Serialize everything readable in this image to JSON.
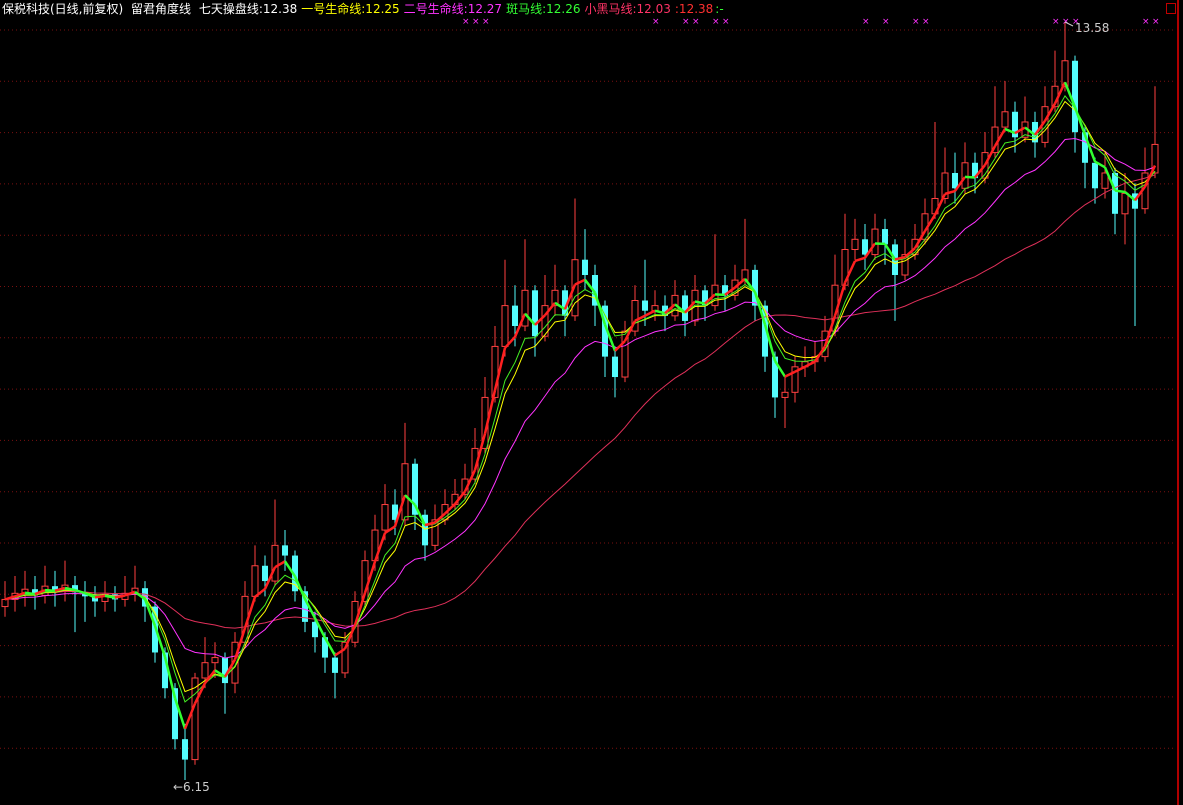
{
  "header": {
    "title": "保税科技(日线,前复权)",
    "indicator": "留君角度线",
    "items": [
      {
        "label": "七天操盘线:12.38",
        "color": "#ffffff"
      },
      {
        "label": "一号生命线:12.25",
        "color": "#ffff00"
      },
      {
        "label": "二号生命线:12.27",
        "color": "#ff33ff"
      },
      {
        "label": "斑马线:12.26",
        "color": "#33ff33"
      },
      {
        "label": "小黑马线:12.03",
        "color": "#ff3366"
      },
      {
        "label": ":12.38",
        "color": "#ff3030"
      },
      {
        "label": ":-",
        "color": "#33ff33"
      }
    ]
  },
  "chart_data": {
    "type": "candlestick",
    "title": "保税科技(日线,前复权)",
    "ylim": [
      6.15,
      13.58
    ],
    "grid": true,
    "colors": {
      "up": "#ff4040",
      "down": "#54fcfc",
      "ma_fast_up": "#ff2020",
      "ma_fast_down": "#30ff30",
      "line1": "#ffff00",
      "line2": "#ff33ff",
      "zebra": "#44ee22",
      "horse": "#e0305a",
      "signal": "#ff33ff",
      "grid": "#7a1010"
    },
    "open": [
      7.85,
      7.92,
      7.98,
      8.02,
      7.96,
      8.05,
      8.0,
      8.06,
      7.99,
      7.95,
      7.9,
      7.97,
      7.92,
      7.98,
      8.03,
      7.85,
      7.4,
      7.05,
      6.55,
      6.35,
      7.15,
      7.3,
      7.35,
      7.1,
      7.5,
      7.95,
      8.25,
      8.1,
      8.45,
      8.35,
      8.0,
      7.7,
      7.55,
      7.35,
      7.2,
      7.5,
      7.9,
      8.3,
      8.6,
      8.85,
      8.7,
      9.25,
      8.75,
      8.45,
      8.7,
      8.85,
      8.95,
      9.1,
      9.4,
      9.9,
      10.4,
      10.8,
      10.6,
      10.95,
      10.5,
      10.8,
      10.95,
      10.7,
      11.25,
      11.1,
      10.8,
      10.3,
      10.1,
      10.55,
      10.85,
      10.75,
      10.8,
      10.7,
      10.9,
      10.65,
      10.95,
      10.8,
      11.0,
      10.9,
      11.05,
      11.15,
      10.8,
      10.3,
      9.9,
      9.95,
      10.2,
      10.25,
      10.3,
      10.55,
      11.0,
      11.35,
      11.45,
      11.3,
      11.55,
      11.4,
      11.1,
      11.3,
      11.45,
      11.7,
      11.85,
      12.1,
      11.95,
      12.2,
      12.05,
      12.3,
      12.55,
      12.7,
      12.45,
      12.6,
      12.4,
      12.75,
      12.95,
      13.2,
      12.5,
      12.2,
      11.95,
      12.1,
      11.7,
      11.9,
      11.75,
      12.1
    ],
    "high": [
      8.1,
      8.15,
      8.2,
      8.15,
      8.25,
      8.2,
      8.3,
      8.15,
      8.1,
      8.05,
      8.1,
      8.05,
      8.15,
      8.25,
      8.1,
      7.9,
      7.45,
      7.1,
      6.7,
      7.2,
      7.55,
      7.5,
      7.4,
      7.6,
      8.1,
      8.45,
      8.35,
      8.9,
      8.6,
      8.4,
      8.05,
      7.8,
      7.6,
      7.4,
      7.6,
      8.0,
      8.4,
      8.75,
      9.05,
      9.0,
      9.65,
      9.3,
      8.8,
      8.85,
      9.0,
      9.1,
      9.25,
      9.6,
      10.1,
      10.6,
      11.25,
      11.0,
      11.45,
      11.0,
      11.1,
      11.2,
      11.0,
      11.85,
      11.55,
      11.2,
      10.85,
      10.4,
      10.65,
      11.0,
      11.25,
      10.95,
      10.9,
      11.05,
      10.95,
      11.1,
      11.0,
      11.5,
      11.1,
      11.2,
      11.65,
      11.2,
      10.85,
      10.35,
      10.1,
      10.3,
      10.4,
      10.45,
      10.7,
      11.3,
      11.7,
      11.65,
      11.6,
      11.7,
      11.65,
      11.45,
      11.45,
      11.6,
      11.85,
      12.6,
      12.35,
      12.3,
      12.4,
      12.3,
      12.5,
      12.95,
      13.0,
      12.8,
      12.85,
      12.7,
      12.95,
      13.3,
      13.58,
      13.25,
      12.55,
      12.25,
      12.3,
      12.15,
      12.1,
      12.0,
      12.35,
      12.95
    ],
    "low": [
      7.75,
      7.8,
      7.85,
      7.82,
      7.88,
      7.85,
      7.9,
      7.6,
      7.7,
      7.75,
      7.8,
      7.8,
      7.85,
      7.9,
      7.7,
      7.3,
      6.95,
      6.45,
      6.15,
      6.3,
      7.05,
      7.15,
      6.8,
      7.0,
      7.45,
      7.9,
      7.95,
      8.05,
      8.2,
      7.9,
      7.6,
      7.4,
      7.2,
      6.95,
      7.15,
      7.45,
      7.85,
      8.2,
      8.5,
      8.55,
      8.65,
      8.6,
      8.3,
      8.4,
      8.65,
      8.8,
      8.9,
      9.05,
      9.35,
      9.85,
      10.3,
      10.4,
      10.55,
      10.3,
      10.45,
      10.7,
      10.5,
      10.65,
      10.95,
      10.6,
      10.1,
      9.9,
      10.05,
      10.5,
      10.6,
      10.65,
      10.55,
      10.65,
      10.5,
      10.6,
      10.65,
      10.75,
      10.75,
      10.85,
      11.0,
      10.65,
      10.15,
      9.7,
      9.6,
      9.85,
      10.1,
      10.15,
      10.25,
      10.5,
      10.95,
      11.25,
      11.15,
      11.25,
      11.2,
      10.65,
      11.05,
      11.25,
      11.4,
      11.65,
      11.8,
      11.8,
      11.9,
      11.9,
      12.0,
      12.25,
      12.5,
      12.3,
      12.4,
      12.25,
      12.35,
      12.7,
      12.9,
      12.3,
      11.95,
      11.8,
      11.85,
      11.5,
      11.4,
      10.6,
      11.7,
      12.05
    ],
    "close": [
      7.92,
      7.98,
      8.02,
      7.96,
      8.05,
      8.0,
      8.06,
      7.99,
      7.95,
      7.9,
      7.97,
      7.92,
      7.98,
      8.03,
      7.85,
      7.4,
      7.05,
      6.55,
      6.35,
      7.15,
      7.3,
      7.35,
      7.1,
      7.5,
      7.95,
      8.25,
      8.1,
      8.45,
      8.35,
      8.0,
      7.7,
      7.55,
      7.35,
      7.2,
      7.5,
      7.9,
      8.3,
      8.6,
      8.85,
      8.7,
      9.25,
      8.75,
      8.45,
      8.7,
      8.85,
      8.95,
      9.1,
      9.4,
      9.9,
      10.4,
      10.8,
      10.6,
      10.95,
      10.5,
      10.8,
      10.95,
      10.7,
      11.25,
      11.1,
      10.8,
      10.3,
      10.1,
      10.55,
      10.85,
      10.75,
      10.8,
      10.7,
      10.9,
      10.65,
      10.95,
      10.8,
      11.0,
      10.9,
      11.05,
      11.15,
      10.8,
      10.3,
      9.9,
      9.95,
      10.2,
      10.25,
      10.3,
      10.55,
      11.0,
      11.35,
      11.45,
      11.3,
      11.55,
      11.4,
      11.1,
      11.3,
      11.45,
      11.7,
      11.85,
      12.1,
      11.95,
      12.2,
      12.05,
      12.3,
      12.55,
      12.7,
      12.45,
      12.6,
      12.4,
      12.75,
      12.95,
      13.2,
      12.5,
      12.2,
      11.95,
      12.1,
      11.7,
      11.9,
      11.75,
      12.1,
      12.38
    ],
    "signal_indices": [
      46,
      47,
      48,
      65,
      68,
      69,
      71,
      72,
      86,
      88,
      91,
      92,
      105,
      106,
      107,
      114,
      115
    ],
    "annotations": {
      "high_label": "13.58",
      "high_index": 106,
      "low_label": "←6.15",
      "low_index": 18
    }
  }
}
